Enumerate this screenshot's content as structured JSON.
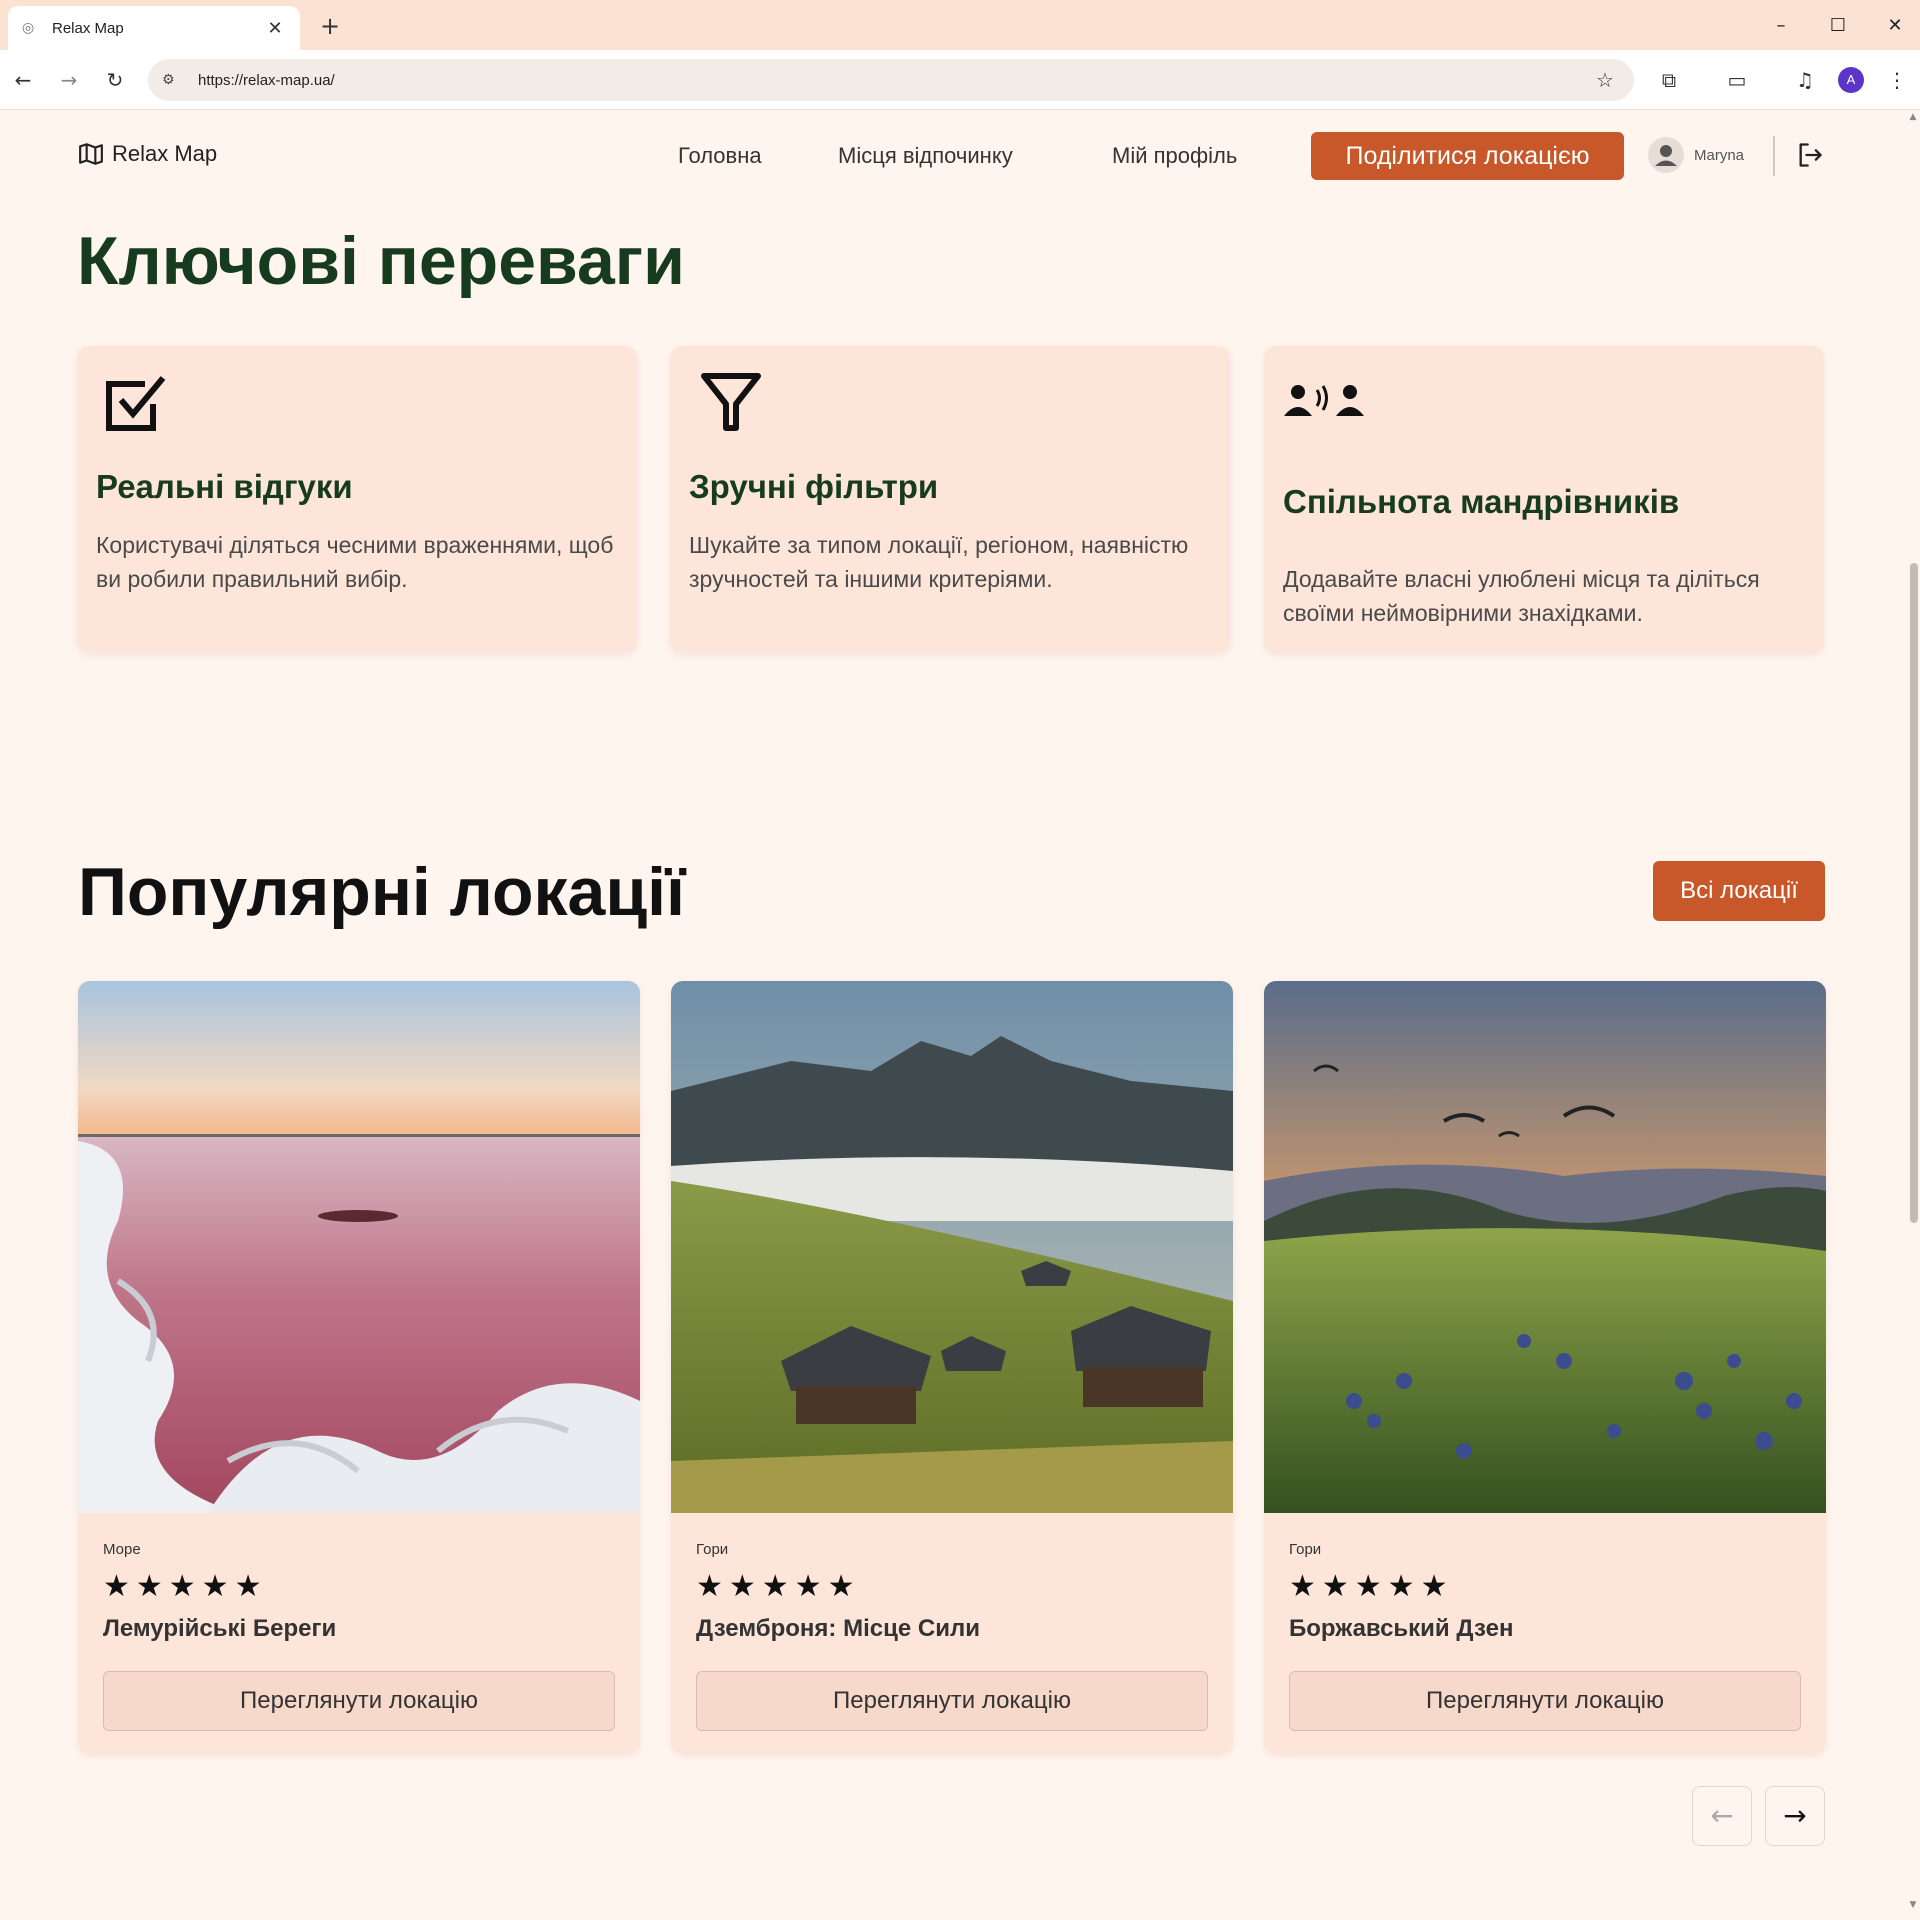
{
  "browser": {
    "tab_title": "Relax Map",
    "url": "https://relax-map.ua/",
    "profile_initial": "A"
  },
  "header": {
    "logo_text": "Relax Map",
    "nav": [
      {
        "label": "Головна"
      },
      {
        "label": "Місця відпочинку"
      },
      {
        "label": "Мій профіль"
      }
    ],
    "share_label": "Поділитися локацією",
    "user_name": "Maryna"
  },
  "advantages": {
    "title": "Ключові переваги",
    "cards": [
      {
        "icon": "checkbox-icon",
        "title": "Реальні відгуки",
        "desc": "Користувачі діляться чесними враженнями, щоб ви робили правильний вибір."
      },
      {
        "icon": "filter-icon",
        "title": "Зручні фільтри",
        "desc": "Шукайте за типом локації, регіоном, наявністю зручностей та іншими критеріями."
      },
      {
        "icon": "community-icon",
        "title": "Спільнота мандрівників",
        "desc": "Додавайте власні улюблені місця та діліться своїми неймовірними знахідками."
      }
    ]
  },
  "popular": {
    "title": "Популярні локації",
    "all_label": "Всі локації",
    "cards": [
      {
        "category": "Море",
        "rating": 5,
        "stars": "★★★★★",
        "name": "Лемурійські Береги",
        "button": "Переглянути локацію"
      },
      {
        "category": "Гори",
        "rating": 5,
        "stars": "★★★★★",
        "name": "Дземброня: Місце Сили",
        "button": "Переглянути локацію"
      },
      {
        "category": "Гори",
        "rating": 5,
        "stars": "★★★★★",
        "name": "Боржавський Дзен",
        "button": "Переглянути локацію"
      }
    ]
  },
  "colors": {
    "accent": "#c8582a",
    "heading_green": "#173b1e",
    "page_bg": "#fff5ef",
    "card_bg": "#fde5da"
  }
}
